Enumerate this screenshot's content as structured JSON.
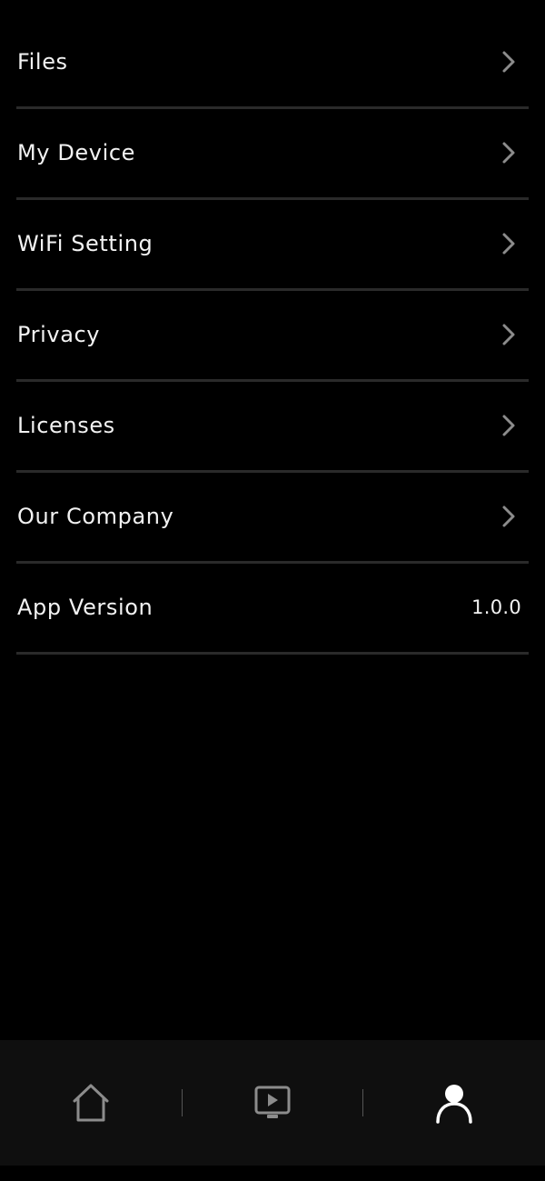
{
  "menu": {
    "items": [
      {
        "label": "Files",
        "type": "link"
      },
      {
        "label": "My Device",
        "type": "link"
      },
      {
        "label": "WiFi Setting",
        "type": "link"
      },
      {
        "label": "Privacy",
        "type": "link"
      },
      {
        "label": "Licenses",
        "type": "link"
      },
      {
        "label": "Our Company",
        "type": "link"
      },
      {
        "label": "App Version",
        "type": "value",
        "value": "1.0.0"
      }
    ]
  },
  "tab_bar": {
    "tabs": [
      {
        "icon": "home-icon",
        "active": false
      },
      {
        "icon": "play-screen-icon",
        "active": false
      },
      {
        "icon": "profile-icon",
        "active": true
      }
    ]
  },
  "colors": {
    "background": "#000000",
    "divider": "#2a2a2a",
    "tab_bar_bg": "#0f0f0f",
    "text": "#f2f2f2",
    "icon_inactive": "#8c8c8c",
    "icon_active": "#ffffff"
  }
}
